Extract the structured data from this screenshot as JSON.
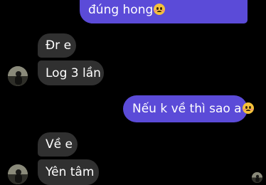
{
  "messages": [
    {
      "side": "out",
      "text": "đúng hong",
      "emoji": "pleading-face-emoji"
    },
    {
      "side": "in",
      "text": "Đr e"
    },
    {
      "side": "in",
      "text": "Log 3 lần"
    },
    {
      "side": "out",
      "text": "Nếu k về thì sao a",
      "emoji": "pleading-face-emoji"
    },
    {
      "side": "in",
      "text": "Về e"
    },
    {
      "side": "in",
      "text": "Yên tâm"
    }
  ],
  "colors": {
    "background": "#000000",
    "incoming_bubble": "#303030",
    "outgoing_bubble": "#5b4bd8",
    "text": "#ffffff"
  }
}
